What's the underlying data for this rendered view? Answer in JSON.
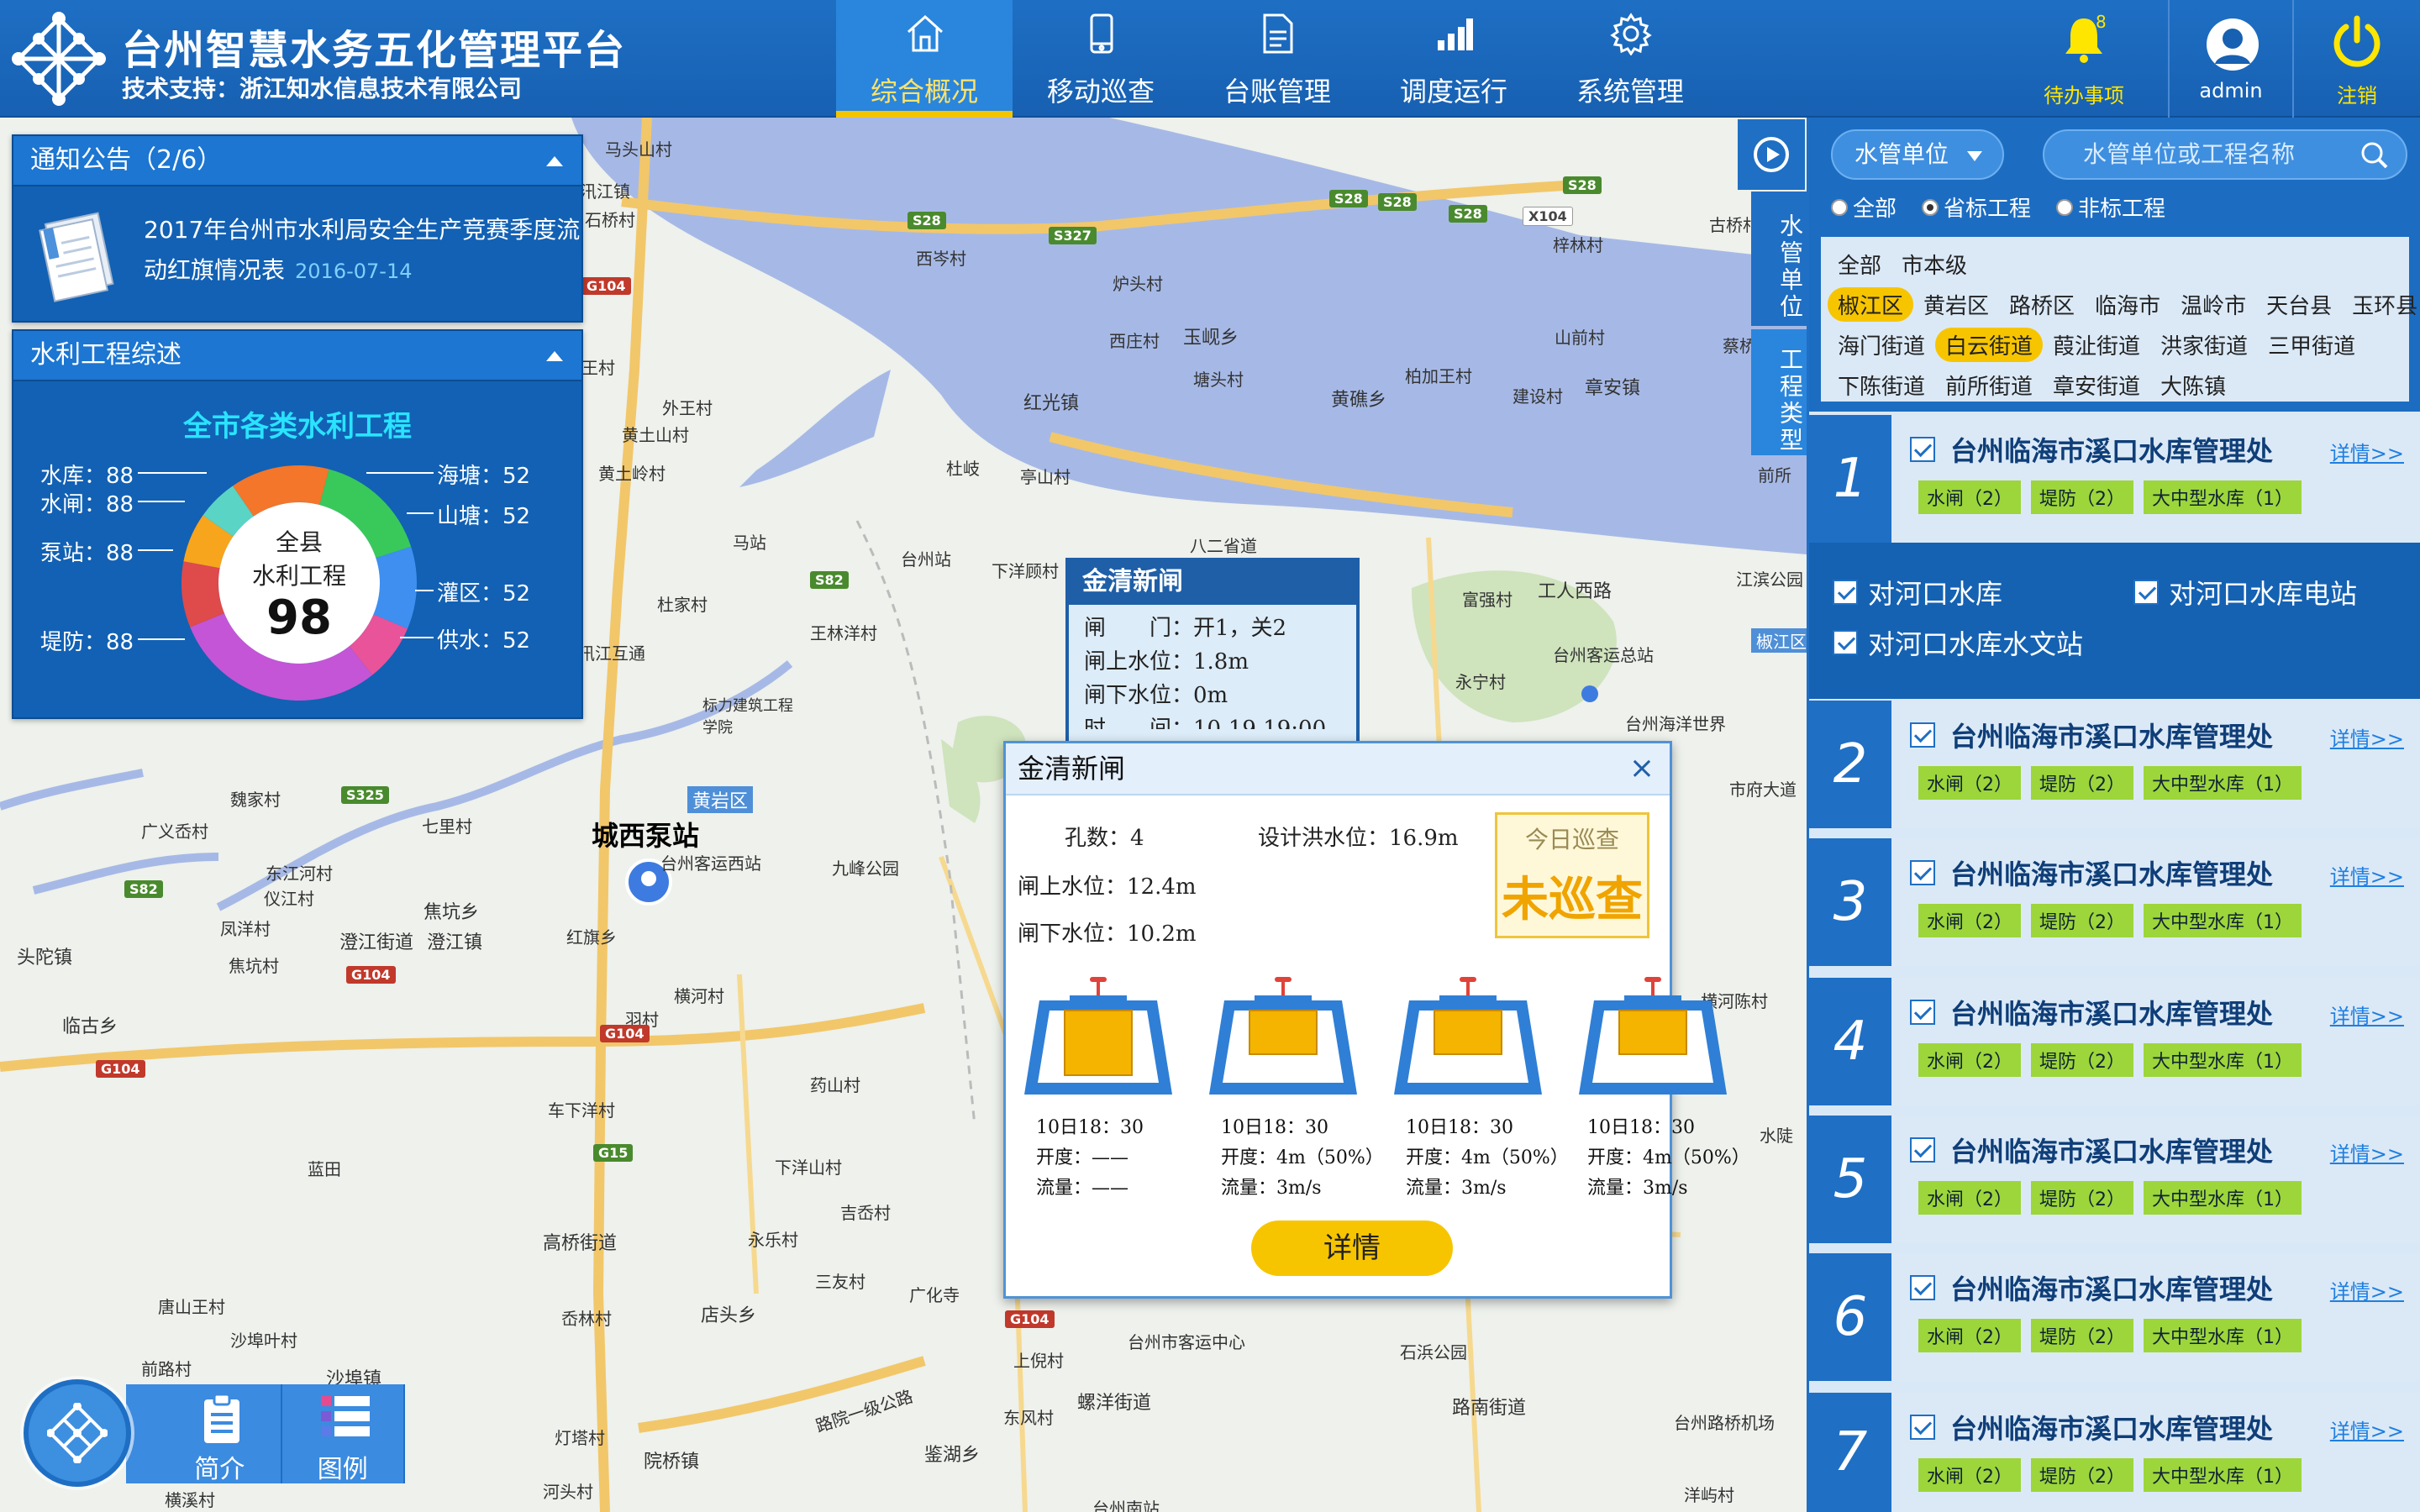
{
  "header": {
    "title": "台州智慧水务五化管理平台",
    "subtitle": "技术支持：浙江知水信息技术有限公司",
    "nav": [
      {
        "label": "综合概况",
        "icon": "home-icon",
        "active": true
      },
      {
        "label": "移动巡查",
        "icon": "phone-icon",
        "active": false
      },
      {
        "label": "台账管理",
        "icon": "document-icon",
        "active": false
      },
      {
        "label": "调度运行",
        "icon": "chart-icon",
        "active": false
      },
      {
        "label": "系统管理",
        "icon": "gear-icon",
        "active": false
      }
    ],
    "todo": {
      "label": "待办事项",
      "count": "8",
      "icon": "bell-icon"
    },
    "user": {
      "label": "admin",
      "icon": "avatar-icon"
    },
    "logout": {
      "label": "注销",
      "icon": "power-icon"
    },
    "colors": {
      "bar": "#1e6fc4",
      "active_underline": "#f3c400",
      "accent_text": "#ffe600"
    }
  },
  "notice": {
    "title": "通知公告（2/6）",
    "text": "2017年台州市水利局安全生产竞赛季度流动红旗情况表",
    "date": "2016-07-14"
  },
  "works": {
    "title": "水利工程综述",
    "heading": "全市各类水利工程",
    "center_label_1": "全县",
    "center_label_2": "水利工程",
    "center_value": "98",
    "left_items": [
      {
        "label": "水库：88"
      },
      {
        "label": "水闸：88"
      },
      {
        "label": "泵站：88"
      },
      {
        "label": "堤防：88"
      }
    ],
    "right_items": [
      {
        "label": "海塘：52"
      },
      {
        "label": "山塘：52"
      },
      {
        "label": "灌区：52"
      },
      {
        "label": "供水：52"
      }
    ],
    "segment_colors": [
      "#f3762a",
      "#39c95a",
      "#3e8ff0",
      "#e9539a",
      "#c455d6",
      "#df4a4a",
      "#f7a51d",
      "#5ad4c4"
    ]
  },
  "map": {
    "places": [
      {
        "name": "马头山村"
      },
      {
        "name": "汛江镇"
      },
      {
        "name": "石桥村"
      },
      {
        "name": "西岑村"
      },
      {
        "name": "炉头村"
      },
      {
        "name": "西庄村"
      },
      {
        "name": "玉岘乡"
      },
      {
        "name": "塘头村"
      },
      {
        "name": "红光镇"
      },
      {
        "name": "黄礁乡"
      },
      {
        "name": "柏加王村"
      },
      {
        "name": "山前村"
      },
      {
        "name": "建设村"
      },
      {
        "name": "章安镇"
      },
      {
        "name": "蔡桥村"
      },
      {
        "name": "梓林村"
      },
      {
        "name": "古桥村"
      },
      {
        "name": "杜岐"
      },
      {
        "name": "亭山村"
      },
      {
        "name": "外王村"
      },
      {
        "name": "黄土山村"
      },
      {
        "name": "黄土岭村"
      },
      {
        "name": "王村"
      },
      {
        "name": "马站"
      },
      {
        "name": "台州站"
      },
      {
        "name": "下洋顾村"
      },
      {
        "name": "八二省道"
      },
      {
        "name": "工人西路"
      },
      {
        "name": "富强村"
      },
      {
        "name": "江滨公园"
      },
      {
        "name": "杜家村"
      },
      {
        "name": "王林洋村"
      },
      {
        "name": "永宁村"
      },
      {
        "name": "台州客运总站"
      },
      {
        "name": "台州海洋世界"
      },
      {
        "name": "前所"
      },
      {
        "name": "椒江区"
      },
      {
        "name": "汛江互通"
      },
      {
        "name": "标力建筑工程学院"
      },
      {
        "name": "黄岩区"
      },
      {
        "name": "魏家村"
      },
      {
        "name": "七里村"
      },
      {
        "name": "广义岙村"
      },
      {
        "name": "东江河村"
      },
      {
        "name": "仪江村"
      },
      {
        "name": "凤洋村"
      },
      {
        "name": "焦坑乡"
      },
      {
        "name": "澄江街道"
      },
      {
        "name": "澄江镇"
      },
      {
        "name": "焦坑村"
      },
      {
        "name": "头陀镇"
      },
      {
        "name": "临古乡"
      },
      {
        "name": "城西泵站"
      },
      {
        "name": "台州客运西站"
      },
      {
        "name": "九峰公园"
      },
      {
        "name": "红旗乡"
      },
      {
        "name": "羽村"
      },
      {
        "name": "横河村"
      },
      {
        "name": "药山村"
      },
      {
        "name": "车下洋村"
      },
      {
        "name": "蓝田"
      },
      {
        "name": "下洋山村"
      },
      {
        "name": "吉岙村"
      },
      {
        "name": "高桥街道"
      },
      {
        "name": "永乐村"
      },
      {
        "name": "三友村"
      },
      {
        "name": "广化寺"
      },
      {
        "name": "店头乡"
      },
      {
        "name": "岙林村"
      },
      {
        "name": "唐山王村"
      },
      {
        "name": "沙埠叶村"
      },
      {
        "name": "前路村"
      },
      {
        "name": "沙埠镇"
      },
      {
        "name": "灯塔村"
      },
      {
        "name": "院桥镇"
      },
      {
        "name": "河头村"
      },
      {
        "name": "横溪村"
      },
      {
        "name": "鉴湖乡"
      },
      {
        "name": "螺洋街道"
      },
      {
        "name": "东风村"
      },
      {
        "name": "上倪村"
      },
      {
        "name": "台州市客运中心"
      },
      {
        "name": "石浜公园"
      },
      {
        "name": "路南街道"
      },
      {
        "name": "台州路桥机场"
      },
      {
        "name": "洋屿村"
      },
      {
        "name": "横河陈村"
      },
      {
        "name": "水陡"
      },
      {
        "name": "市府大道"
      },
      {
        "name": "台州南站"
      },
      {
        "name": "路院一级公路"
      }
    ],
    "roads": [
      "S28",
      "S28",
      "S28",
      "S28",
      "S28",
      "S327",
      "X104",
      "G104",
      "S82",
      "S325",
      "S82",
      "G104",
      "G104",
      "G104",
      "G15",
      "G104"
    ]
  },
  "callout": {
    "title": "金清新闸",
    "rows": [
      "闸　　门：开1，关2",
      "闸上水位：1.8m",
      "闸下水位：0m",
      "时　　间：10-19 19:00"
    ]
  },
  "popup": {
    "title": "金清新闸",
    "holes": "孔数：4",
    "design_level": "设计洪水位：16.9m",
    "upper_level": "闸上水位：12.4m",
    "lower_level": "闸下水位：10.2m",
    "stamp_top": "今日巡查",
    "stamp_main": "未巡查",
    "gates": [
      {
        "time": "10日18：30",
        "open": "开度：——",
        "flow": "流量：——",
        "fill": 0.85
      },
      {
        "time": "10日18：30",
        "open": "开度：4m（50%）",
        "flow": "流量：3m/s",
        "fill": 0.5
      },
      {
        "time": "10日18：30",
        "open": "开度：4m（50%）",
        "flow": "流量：3m/s",
        "fill": 0.5
      },
      {
        "time": "10日18：30",
        "open": "开度：4m（50%）",
        "flow": "流量：3m/s",
        "fill": 0.5
      }
    ],
    "detail_label": "详情"
  },
  "side_tabs": {
    "tab1": "水管单位",
    "tab2": "工程类型"
  },
  "tools": {
    "intro": "简介",
    "legend": "图例"
  },
  "right": {
    "select_label": "水管单位",
    "search_placeholder": "水管单位或工程名称",
    "radios": [
      {
        "label": "全部",
        "checked": false
      },
      {
        "label": "省标工程",
        "checked": true
      },
      {
        "label": "非标工程",
        "checked": false
      }
    ],
    "region_rows": [
      [
        {
          "label": "全部",
          "on": false
        },
        {
          "label": "市本级",
          "on": false
        }
      ],
      [
        {
          "label": "椒江区",
          "on": true
        },
        {
          "label": "黄岩区",
          "on": false
        },
        {
          "label": "路桥区",
          "on": false
        },
        {
          "label": "临海市",
          "on": false
        },
        {
          "label": "温岭市",
          "on": false
        },
        {
          "label": "天台县",
          "on": false
        },
        {
          "label": "玉环县",
          "on": false
        }
      ],
      [
        {
          "label": "海门街道",
          "on": false
        },
        {
          "label": "白云街道",
          "on": true
        },
        {
          "label": "葭沚街道",
          "on": false
        },
        {
          "label": "洪家街道",
          "on": false
        },
        {
          "label": "三甲街道",
          "on": false
        }
      ],
      [
        {
          "label": "下陈街道",
          "on": false
        },
        {
          "label": "前所街道",
          "on": false
        },
        {
          "label": "章安街道",
          "on": false
        },
        {
          "label": "大陈镇",
          "on": false
        }
      ]
    ],
    "cards": [
      {
        "num": "1",
        "title": "台州临海市溪口水库管理处",
        "more": "详情>>",
        "tags": [
          "水闸（2）",
          "堤防（2）",
          "大中型水库（1）"
        ]
      },
      {
        "num": "2",
        "title": "台州临海市溪口水库管理处",
        "more": "详情>>",
        "tags": [
          "水闸（2）",
          "堤防（2）",
          "大中型水库（1）"
        ]
      },
      {
        "num": "3",
        "title": "台州临海市溪口水库管理处",
        "more": "详情>>",
        "tags": [
          "水闸（2）",
          "堤防（2）",
          "大中型水库（1）"
        ]
      },
      {
        "num": "4",
        "title": "台州临海市溪口水库管理处",
        "more": "详情>>",
        "tags": [
          "水闸（2）",
          "堤防（2）",
          "大中型水库（1）"
        ]
      },
      {
        "num": "5",
        "title": "台州临海市溪口水库管理处",
        "more": "详情>>",
        "tags": [
          "水闸（2）",
          "堤防（2）",
          "大中型水库（1）"
        ]
      },
      {
        "num": "6",
        "title": "台州临海市溪口水库管理处",
        "more": "详情>>",
        "tags": [
          "水闸（2）",
          "堤防（2）",
          "大中型水库（1）"
        ]
      },
      {
        "num": "7",
        "title": "台州临海市溪口水库管理处",
        "more": "详情>>",
        "tags": [
          "水闸（2）",
          "堤防（2）",
          "大中型水库（1）"
        ]
      }
    ],
    "expanded": [
      "对河口水库",
      "对河口水库电站",
      "对河口水库水文站"
    ]
  }
}
